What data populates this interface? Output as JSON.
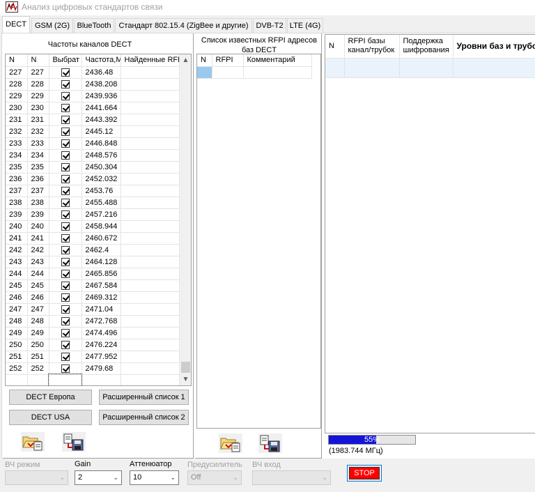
{
  "window": {
    "title": "Анализ цифровых стандартов связи",
    "icon": "app-logo-icon"
  },
  "tabs": [
    {
      "label": "DECT",
      "active": true
    },
    {
      "label": "GSM (2G)"
    },
    {
      "label": "BlueTooth"
    },
    {
      "label": "Стандарт 802.15.4 (ZigBee и другие)"
    },
    {
      "label": "DVB-T2"
    },
    {
      "label": "LTE (4G)"
    }
  ],
  "channels": {
    "caption": "Частоты каналов DECT",
    "columns": [
      "N",
      "N",
      "Выбрат",
      "Частота,М",
      "Найденные RFPI"
    ],
    "rows": [
      [
        "227",
        "227",
        "2436.48"
      ],
      [
        "228",
        "228",
        "2438.208"
      ],
      [
        "229",
        "229",
        "2439.936"
      ],
      [
        "230",
        "230",
        "2441.664"
      ],
      [
        "231",
        "231",
        "2443.392"
      ],
      [
        "232",
        "232",
        "2445.12"
      ],
      [
        "233",
        "233",
        "2446.848"
      ],
      [
        "234",
        "234",
        "2448.576"
      ],
      [
        "235",
        "235",
        "2450.304"
      ],
      [
        "236",
        "236",
        "2452.032"
      ],
      [
        "237",
        "237",
        "2453.76"
      ],
      [
        "238",
        "238",
        "2455.488"
      ],
      [
        "239",
        "239",
        "2457.216"
      ],
      [
        "240",
        "240",
        "2458.944"
      ],
      [
        "241",
        "241",
        "2460.672"
      ],
      [
        "242",
        "242",
        "2462.4"
      ],
      [
        "243",
        "243",
        "2464.128"
      ],
      [
        "244",
        "244",
        "2465.856"
      ],
      [
        "245",
        "245",
        "2467.584"
      ],
      [
        "246",
        "246",
        "2469.312"
      ],
      [
        "247",
        "247",
        "2471.04"
      ],
      [
        "248",
        "248",
        "2472.768"
      ],
      [
        "249",
        "249",
        "2474.496"
      ],
      [
        "250",
        "250",
        "2476.224"
      ],
      [
        "251",
        "251",
        "2477.952"
      ],
      [
        "252",
        "252",
        "2479.68"
      ]
    ],
    "buttons": {
      "europe": "DECT Европа",
      "usa": "DECT USA",
      "ext1": "Расширенный список 1",
      "ext2": "Расширенный список 2"
    },
    "icons": [
      "open-folder-icon",
      "save-list-icon"
    ]
  },
  "rfpi": {
    "caption": "Список известных RFPI адресов баз DECT",
    "columns": [
      "N",
      "RFPI",
      "Комментарий"
    ],
    "icons": [
      "open-folder-icon",
      "save-list-icon"
    ]
  },
  "bases": {
    "columns": [
      "N",
      "RFPI базы канал/трубок",
      "Поддержка шифрования",
      "Уровни баз и трубок"
    ]
  },
  "progress": {
    "value": 0.55,
    "label": "55%",
    "freq": "(1983.744 МГц)",
    "color": "#1414d8"
  },
  "controls": {
    "vch_mode": {
      "label": "ВЧ режим",
      "value": ""
    },
    "gain": {
      "label": "Gain",
      "value": "2"
    },
    "attenuator": {
      "label": "Аттенюатор",
      "value": "10"
    },
    "preamp": {
      "label": "Предусилитель",
      "value": "Off"
    },
    "vch_input": {
      "label": "ВЧ вход",
      "value": ""
    },
    "stop": "STOP",
    "stop_color": "#ff0000"
  }
}
